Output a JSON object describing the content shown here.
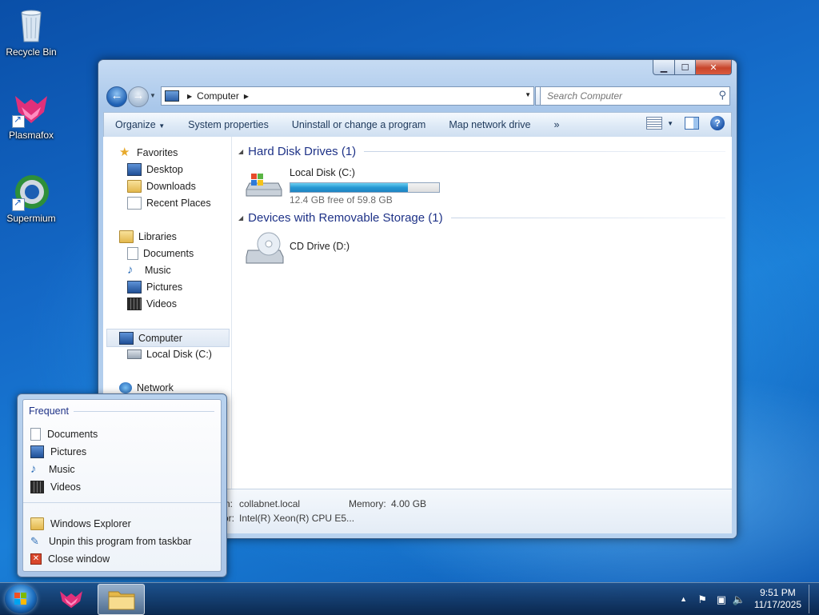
{
  "desktop": {
    "icons": [
      {
        "label": "Recycle Bin",
        "icon": "recycle-bin-icon"
      },
      {
        "label": "Plasmafox",
        "icon": "plasmafox-icon"
      },
      {
        "label": "Supermium",
        "icon": "supermium-icon"
      }
    ]
  },
  "window": {
    "address": {
      "location": "Computer"
    },
    "search": {
      "placeholder": "Search Computer"
    },
    "toolbar": {
      "organize": "Organize",
      "system_properties": "System properties",
      "uninstall": "Uninstall or change a program",
      "map_drive": "Map network drive",
      "more": "»"
    },
    "sidebar": {
      "favorites": "Favorites",
      "desktop": "Desktop",
      "downloads": "Downloads",
      "recent": "Recent Places",
      "libraries": "Libraries",
      "documents": "Documents",
      "music": "Music",
      "pictures": "Pictures",
      "videos": "Videos",
      "computer": "Computer",
      "local_disk": "Local Disk (C:)",
      "network": "Network"
    },
    "groups": {
      "hdd": "Hard Disk Drives (1)",
      "removable": "Devices with Removable Storage (1)"
    },
    "drives": {
      "c": {
        "name": "Local Disk (C:)",
        "free": "12.4 GB free of 59.8 GB",
        "used_fraction": 0.79
      },
      "d": {
        "name": "CD Drive (D:)"
      }
    },
    "details": {
      "domain_label_tail": "n:",
      "domain": "collabnet.local",
      "memory_label": "Memory:",
      "memory": "4.00 GB",
      "processor_label_tail": "or:",
      "processor": "Intel(R) Xeon(R) CPU E5..."
    }
  },
  "jumplist": {
    "section": "Frequent",
    "frequent": [
      "Documents",
      "Pictures",
      "Music",
      "Videos"
    ],
    "tasks": [
      "Windows Explorer",
      "Unpin this program from taskbar",
      "Close window"
    ]
  },
  "taskbar": {
    "time": "9:51 PM",
    "date": "11/17/2025"
  }
}
